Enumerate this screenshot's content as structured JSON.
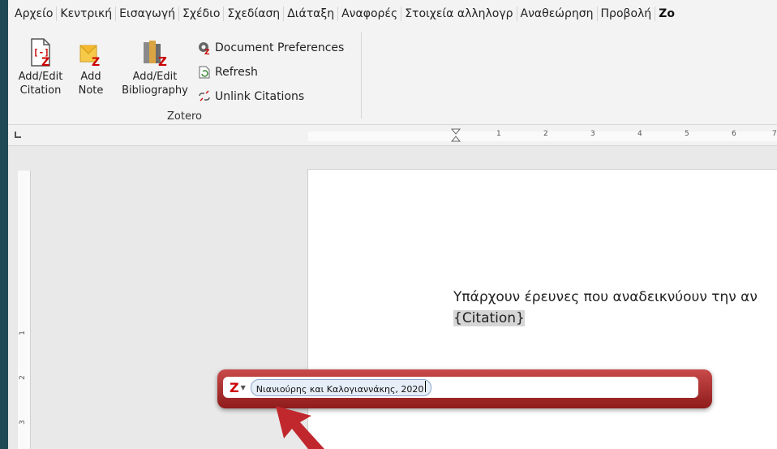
{
  "menu": {
    "items": [
      {
        "label": "Αρχείο"
      },
      {
        "label": "Κεντρική"
      },
      {
        "label": "Εισαγωγή"
      },
      {
        "label": "Σχέδιο"
      },
      {
        "label": "Σχεδίαση"
      },
      {
        "label": "Διάταξη"
      },
      {
        "label": "Αναφορές"
      },
      {
        "label": "Στοιχεία αλληλογρ"
      },
      {
        "label": "Αναθεώρηση"
      },
      {
        "label": "Προβολή"
      },
      {
        "label": "Zo"
      }
    ]
  },
  "ribbon": {
    "add_edit_citation": {
      "line1": "Add/Edit",
      "line2": "Citation"
    },
    "add_note": {
      "line1": "Add",
      "line2": "Note"
    },
    "add_edit_bibliography": {
      "line1": "Add/Edit",
      "line2": "Bibliography"
    },
    "document_preferences": "Document Preferences",
    "refresh": "Refresh",
    "unlink_citations": "Unlink Citations",
    "group_label": "Zotero"
  },
  "ruler": {
    "numbers": [
      "1",
      "2",
      "3",
      "4",
      "5",
      "6",
      "7"
    ],
    "vnumbers": [
      "1",
      "2",
      "3"
    ]
  },
  "document": {
    "line1": "Υπάρχουν έρευνες που αναδεικνύουν την αν",
    "citation_placeholder": "{Citation}"
  },
  "quick_format": {
    "logo": "Z",
    "citation_bubble": "Νιανιούρης και Καλογιαννάκης, 2020"
  },
  "colors": {
    "accent": "#b52a2a",
    "arrow": "#c0282d"
  }
}
